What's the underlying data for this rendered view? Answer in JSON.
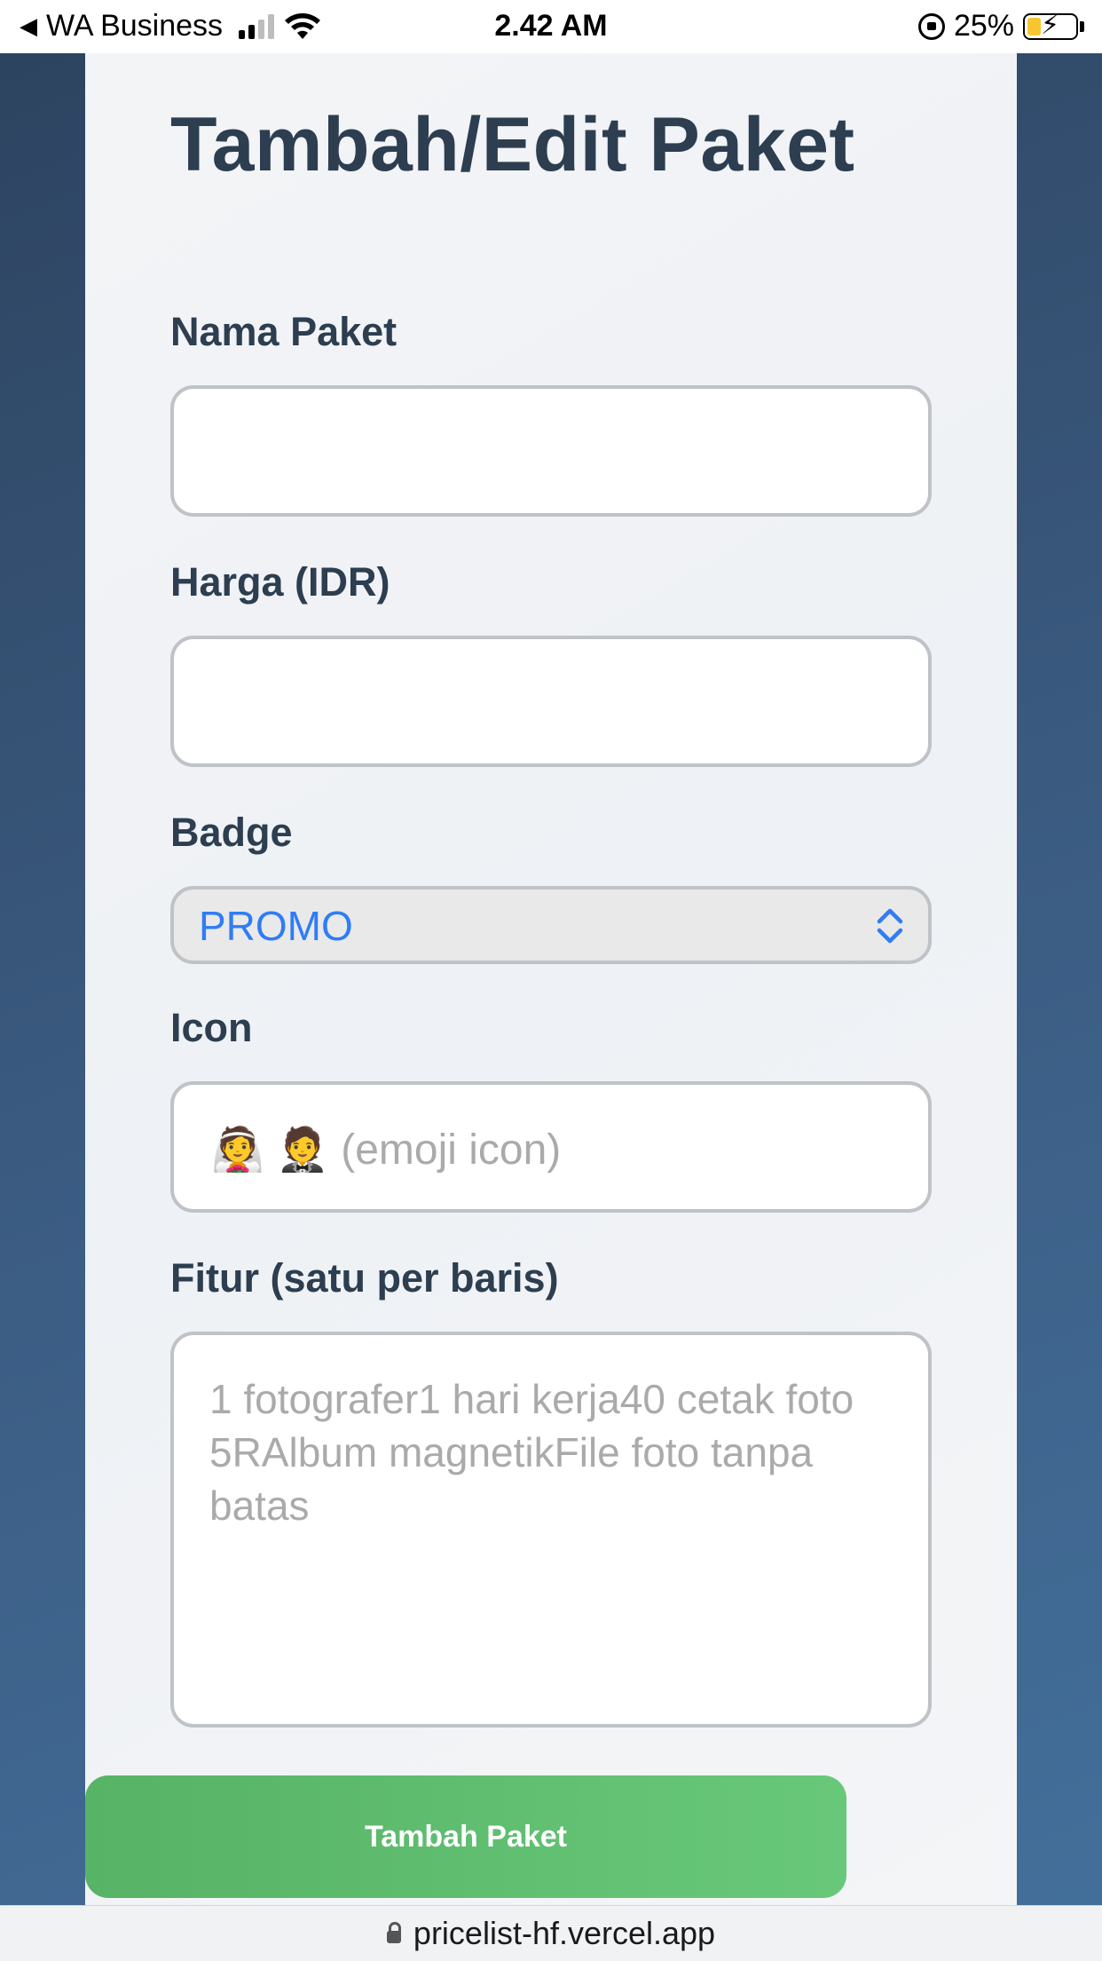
{
  "status_bar": {
    "back_app": "WA Business",
    "time": "2.42 AM",
    "battery_percent": "25%",
    "battery_level": 0.25,
    "signal_bars": 2,
    "signal_total": 4
  },
  "page": {
    "title": "Tambah/Edit Paket"
  },
  "form": {
    "nama_paket": {
      "label": "Nama Paket",
      "value": "",
      "placeholder": ""
    },
    "harga": {
      "label": "Harga (IDR)",
      "value": "",
      "placeholder": ""
    },
    "badge": {
      "label": "Badge",
      "selected": "PROMO"
    },
    "icon": {
      "label": "Icon",
      "placeholder": "👰 🤵  (emoji icon)"
    },
    "fitur": {
      "label": "Fitur (satu per baris)",
      "placeholder": "1 fotografer1 hari kerja40 cetak foto 5RAlbum magnetikFile foto tanpa batas"
    },
    "submit_label": "Tambah Paket"
  },
  "browser": {
    "url": "pricelist-hf.vercel.app"
  },
  "colors": {
    "accent": "#2f7cf6",
    "submit": "#5cb96c",
    "title": "#2c3e50",
    "background": "#3c5d84"
  }
}
